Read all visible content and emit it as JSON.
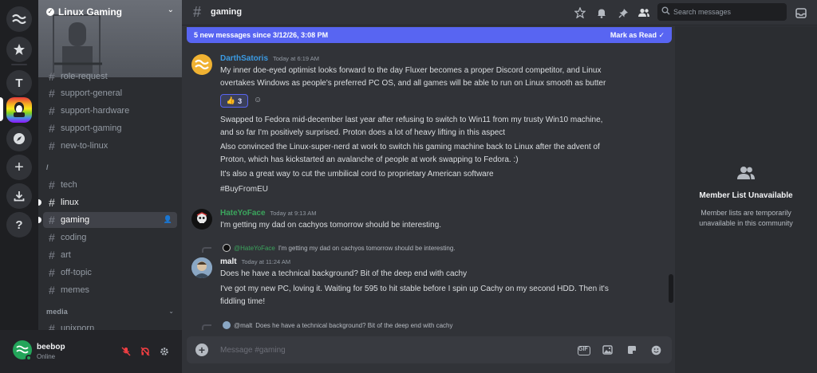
{
  "server": {
    "name": "Linux Gaming"
  },
  "rail": {
    "server_t_label": "T",
    "help_label": "?"
  },
  "channels": {
    "partial_top": "role-request",
    "group1": [
      "support-general",
      "support-hardware",
      "support-gaming",
      "new-to-linux"
    ],
    "cat2_label": "/",
    "group2": [
      "tech",
      "linux",
      "gaming",
      "coding",
      "art",
      "off-topic",
      "memes"
    ],
    "cat3_label": "media",
    "group3": [
      "unixporn"
    ]
  },
  "user": {
    "name": "beebop",
    "status": "Online"
  },
  "topbar": {
    "channel": "gaming",
    "search_placeholder": "Search messages"
  },
  "new_messages": {
    "text": "5 new messages since 3/12/26, 3:08 PM",
    "mark_read": "Mark as Read"
  },
  "messages": [
    {
      "author": "DarthSatoris",
      "author_color": "#3b9be3",
      "time": "Today at 6:19 AM",
      "lines": [
        "My inner doe-eyed optimist looks forward to the day Fluxer becomes a proper Discord competitor, and Linux",
        "overtakes Windows as people's preferred PC OS, and all games will be able to run on Linux smooth as butter"
      ],
      "reaction": {
        "emoji": "👍",
        "count": "3"
      },
      "followups": [
        "Swapped to Fedora mid-december last year after refusing to switch to Win11 from my trusty Win10 machine,",
        "and so far I'm positively surprised. Proton does a lot of heavy lifting in this aspect",
        "Also convinced the Linux-super-nerd at work to switch his gaming machine back to Linux after the advent of",
        "Proton, which has kickstarted an avalanche of people at work swapping to Fedora. :)",
        "It's also a great way to cut the umbilical cord to proprietary American software",
        "#BuyFromEU"
      ]
    },
    {
      "author": "HateYoFace",
      "author_color": "#3ba55d",
      "time": "Today at 9:13 AM",
      "lines": [
        "I'm getting my dad on cachyos tomorrow should be interesting."
      ]
    },
    {
      "reply_to": "@HateYoFace",
      "reply_text": "I'm getting my dad on cachyos tomorrow should be interesting.",
      "author": "malt",
      "author_color": "#f2f3f5",
      "time": "Today at 11:24 AM",
      "lines": [
        "Does he have a technical background? Bit of the deep end with cachy",
        "I've got my new PC, loving it. Waiting for 595 to hit stable before I spin up Cachy on my second HDD. Then it's",
        "fiddling time!"
      ]
    },
    {
      "reply_to": "@malt",
      "reply_text": "Does he have a technical background? Bit of the deep end with cachy"
    }
  ],
  "composer": {
    "placeholder": "Message #gaming",
    "gif_label": "GIF"
  },
  "member_panel": {
    "title": "Member List Unavailable",
    "subtitle": "Member lists are temporarily unavailable in this community"
  },
  "colors": {
    "accent": "#5865f2",
    "online": "#23a55a",
    "muted_red": "#f23f43"
  }
}
